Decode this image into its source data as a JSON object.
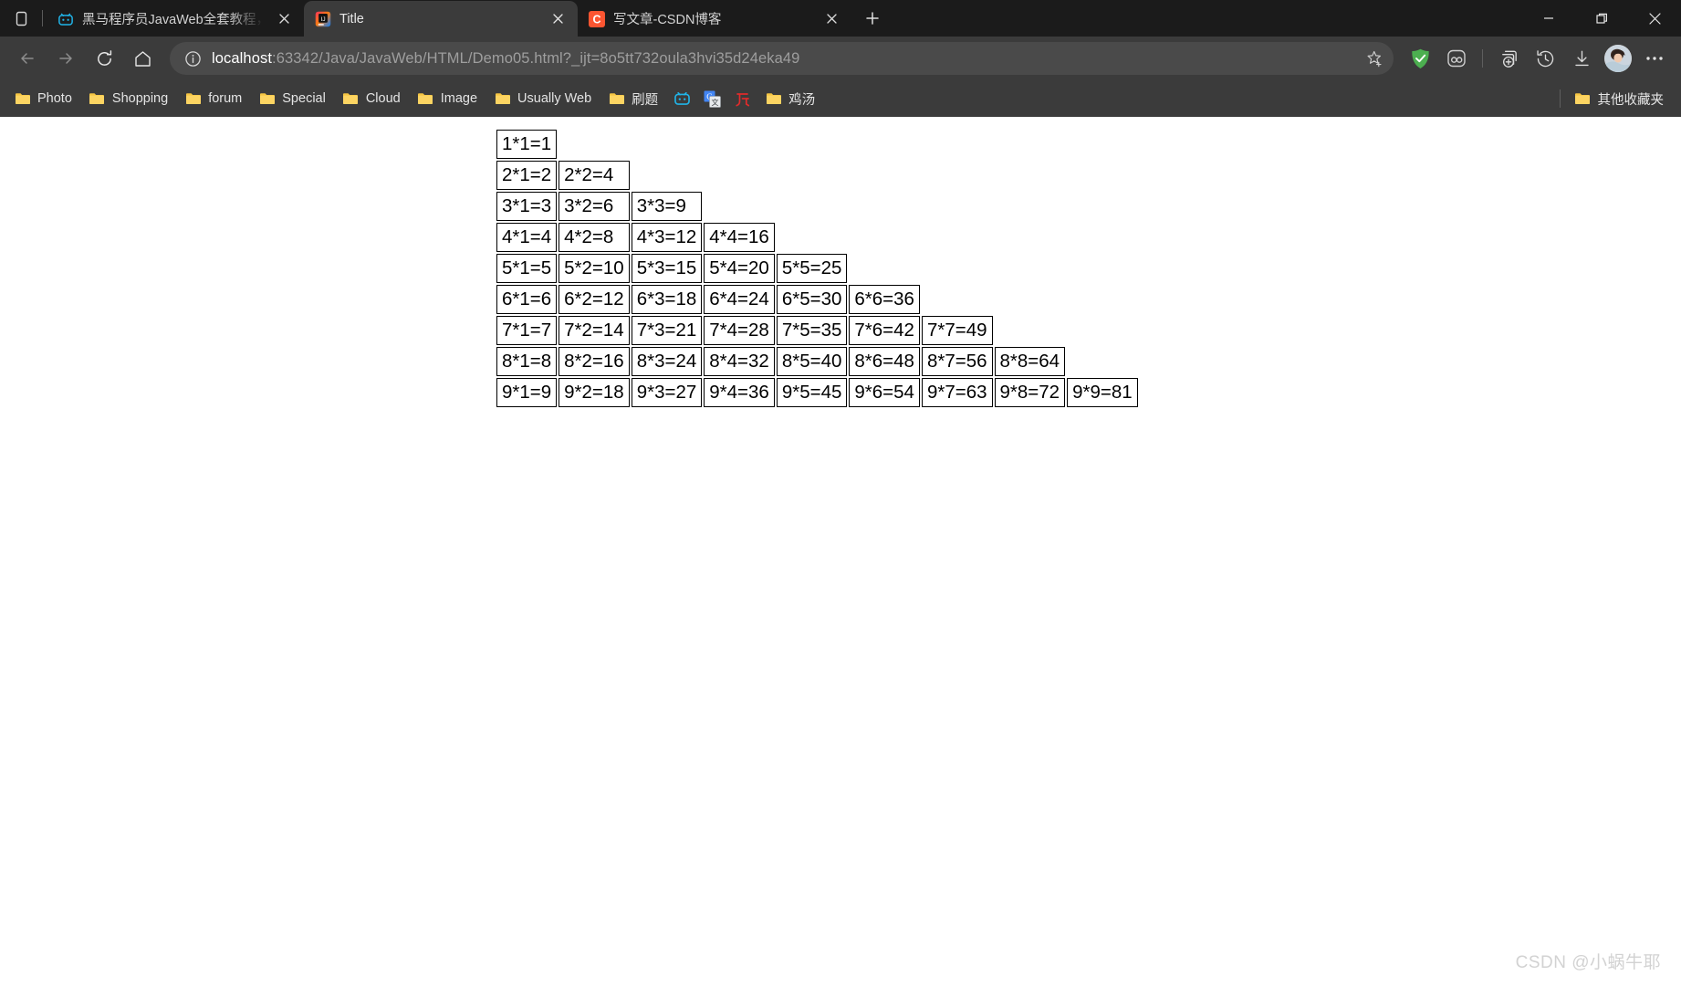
{
  "window": {
    "controls": {
      "minimize": "Minimize",
      "restore": "Restore",
      "close": "Close"
    },
    "tab_search_label": "Tab actions"
  },
  "tabs": [
    {
      "title": "黑马程序员JavaWeb全套教程，J",
      "icon": "bilibili-icon",
      "active": false,
      "close_label": "Close tab"
    },
    {
      "title": "Title",
      "icon": "intellij-idea-icon",
      "active": true,
      "close_label": "Close tab"
    },
    {
      "title": "写文章-CSDN博客",
      "icon": "csdn-icon",
      "active": false,
      "close_label": "Close tab"
    }
  ],
  "new_tab": {
    "label": "New tab",
    "icon": "plus-icon"
  },
  "navigation": {
    "back": {
      "label": "Back",
      "icon": "arrow-left-icon",
      "enabled": false
    },
    "forward": {
      "label": "Forward",
      "icon": "arrow-right-icon",
      "enabled": false
    },
    "refresh": {
      "label": "Refresh",
      "icon": "reload-icon"
    },
    "home": {
      "label": "Home",
      "icon": "home-icon"
    }
  },
  "address_bar": {
    "info_icon": "info-circle-icon",
    "host": "localhost",
    "path": ":63342/Java/JavaWeb/HTML/Demo05.html?_ijt=8o5tt732oula3hvi35d24eka49",
    "full_url": "localhost:63342/Java/JavaWeb/HTML/Demo05.html?_ijt=8o5tt732oula3hvi35d24eka49",
    "favorite": {
      "label": "Add this page to favorites",
      "icon": "star-plus-icon"
    }
  },
  "toolbar": {
    "items": [
      {
        "name": "adguard-shield-icon",
        "label": "AdGuard",
        "color": "#4caf50"
      },
      {
        "name": "extension-oo-icon",
        "label": "Extension"
      },
      {
        "name": "collections-icon",
        "label": "Collections"
      },
      {
        "name": "history-icon",
        "label": "History"
      },
      {
        "name": "downloads-icon",
        "label": "Downloads"
      },
      {
        "name": "profile-avatar",
        "label": "Profile"
      },
      {
        "name": "settings-more-icon",
        "label": "Settings and more"
      }
    ]
  },
  "bookmarks": {
    "items": [
      {
        "label": "Photo",
        "icon": "folder-icon"
      },
      {
        "label": "Shopping",
        "icon": "folder-icon"
      },
      {
        "label": "forum",
        "icon": "folder-icon"
      },
      {
        "label": "Special",
        "icon": "folder-icon"
      },
      {
        "label": "Cloud",
        "icon": "folder-icon"
      },
      {
        "label": "Image",
        "icon": "folder-icon"
      },
      {
        "label": "Usually Web",
        "icon": "folder-icon"
      },
      {
        "label": "刷题",
        "icon": "folder-icon"
      },
      {
        "label": "",
        "icon": "bilibili-icon"
      },
      {
        "label": "",
        "icon": "google-translate-icon"
      },
      {
        "label": "",
        "icon": "zhihu-icon"
      },
      {
        "label": "鸡汤",
        "icon": "folder-icon"
      }
    ],
    "other_bookmarks": {
      "label": "其他收藏夹",
      "icon": "folder-icon"
    }
  },
  "page": {
    "title": "Title",
    "watermark": "CSDN @小蜗牛耶",
    "multiplication_table": {
      "rows": [
        [
          "1*1=1"
        ],
        [
          "2*1=2",
          "2*2=4"
        ],
        [
          "3*1=3",
          "3*2=6",
          "3*3=9"
        ],
        [
          "4*1=4",
          "4*2=8",
          "4*3=12",
          "4*4=16"
        ],
        [
          "5*1=5",
          "5*2=10",
          "5*3=15",
          "5*4=20",
          "5*5=25"
        ],
        [
          "6*1=6",
          "6*2=12",
          "6*3=18",
          "6*4=24",
          "6*5=30",
          "6*6=36"
        ],
        [
          "7*1=7",
          "7*2=14",
          "7*3=21",
          "7*4=28",
          "7*5=35",
          "7*6=42",
          "7*7=49"
        ],
        [
          "8*1=8",
          "8*2=16",
          "8*3=24",
          "8*4=32",
          "8*5=40",
          "8*6=48",
          "8*7=56",
          "8*8=64"
        ],
        [
          "9*1=9",
          "9*2=18",
          "9*3=27",
          "9*4=36",
          "9*5=45",
          "9*6=54",
          "9*7=63",
          "9*8=72",
          "9*9=81"
        ]
      ]
    }
  },
  "colors": {
    "titlebar_bg": "#1b1b1b",
    "chrome_bg": "#3b3b3b",
    "active_tab_bg": "#3b3b3b",
    "omnibox_bg": "#4a4a4a",
    "page_bg": "#ffffff",
    "folder_yellow": "#f0c040",
    "bilibili_blue": "#20b4e8",
    "csdn_red": "#fc5531",
    "adguard_green": "#4caf50"
  }
}
